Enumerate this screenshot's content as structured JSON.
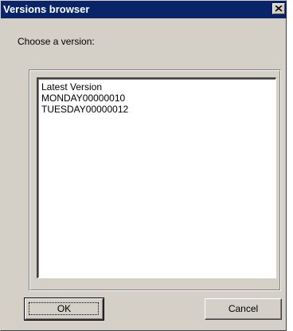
{
  "window": {
    "title": "Versions browser"
  },
  "prompt_label": "Choose a version:",
  "versions": [
    "Latest Version",
    "MONDAY00000010",
    "TUESDAY00000012"
  ],
  "buttons": {
    "ok_label": "OK",
    "cancel_label": "Cancel"
  },
  "icons": {
    "close": "close-icon"
  },
  "colors": {
    "titlebar": "#0a246a",
    "face": "#d4d0c8"
  }
}
